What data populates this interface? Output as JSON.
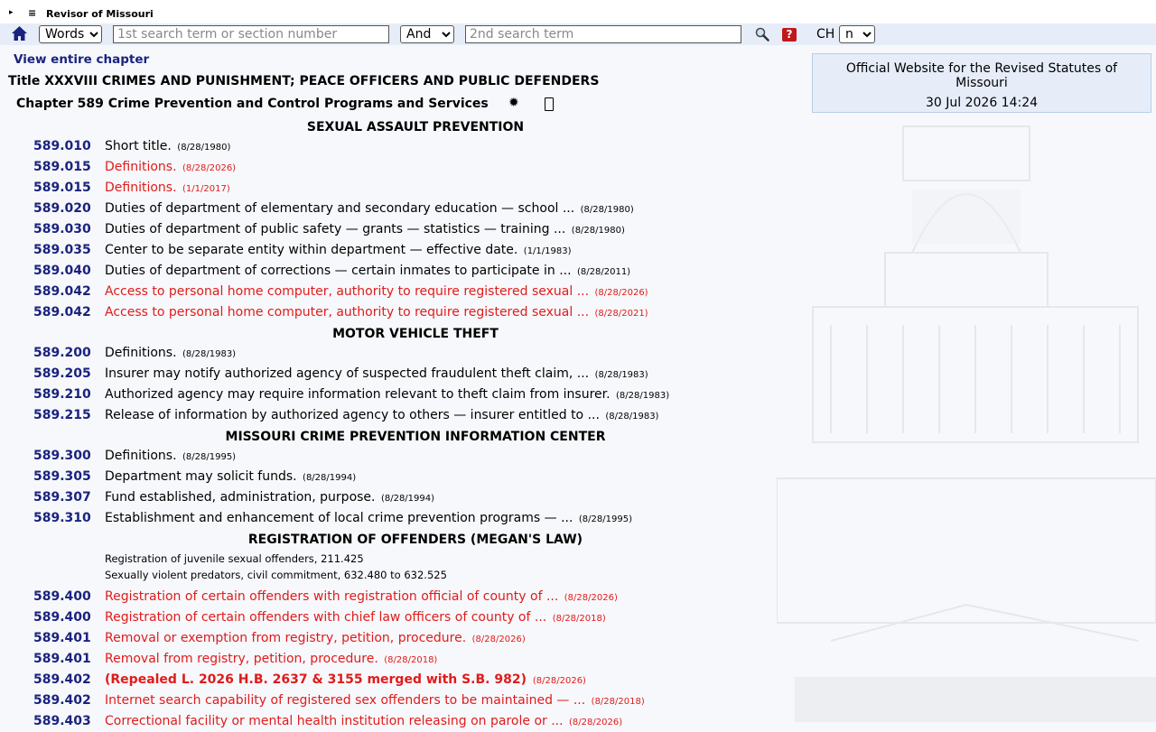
{
  "topbar": {
    "expand_glyph": "▸",
    "menu_glyph": "≡",
    "site_name": "Revisor of Missouri"
  },
  "search": {
    "mode_selected": "Words",
    "term1_placeholder": "1st search term or section number",
    "operator_selected": "And",
    "term2_placeholder": "2nd search term",
    "help_label": "?",
    "ch_label": "CH",
    "ch_selected": "n"
  },
  "nav": {
    "view_chapter": "View entire chapter"
  },
  "header": {
    "title": "Title XXXVIII CRIMES AND PUNISHMENT; PEACE OFFICERS AND PUBLIC DEFENDERS",
    "chapter": "Chapter 589 Crime Prevention and Control Programs and Services",
    "star_glyph": "✹"
  },
  "info": {
    "line1": "Official Website for the Revised Statutes of Missouri",
    "line2": "30 Jul 2026 14:24"
  },
  "headings": [
    "SEXUAL ASSAULT PREVENTION",
    "MOTOR VEHICLE THEFT",
    "MISSOURI CRIME PREVENTION INFORMATION CENTER",
    "REGISTRATION OF OFFENDERS (MEGAN'S LAW)"
  ],
  "notes": [
    "Registration of juvenile sexual offenders, 211.425",
    "Sexually violent predators, civil commitment, 632.480 to 632.525"
  ],
  "sections": [
    {
      "num": "589.010",
      "desc": "Short title.",
      "date": "(8/28/1980)",
      "style": "normal"
    },
    {
      "num": "589.015",
      "desc": "Definitions.",
      "date": "(8/28/2026)",
      "style": "red"
    },
    {
      "num": "589.015",
      "desc": "Definitions.",
      "date": "(1/1/2017)",
      "style": "red"
    },
    {
      "num": "589.020",
      "desc": "Duties of department of elementary and secondary education — school ...",
      "date": "(8/28/1980)",
      "style": "normal"
    },
    {
      "num": "589.030",
      "desc": "Duties of department of public safety — grants — statistics — training ...",
      "date": "(8/28/1980)",
      "style": "normal"
    },
    {
      "num": "589.035",
      "desc": "Center to be separate entity within department — effective date.",
      "date": "(1/1/1983)",
      "style": "normal"
    },
    {
      "num": "589.040",
      "desc": "Duties of department of corrections — certain inmates to participate in ...",
      "date": "(8/28/2011)",
      "style": "normal"
    },
    {
      "num": "589.042",
      "desc": "Access to personal home computer, authority to require registered sexual ...",
      "date": "(8/28/2026)",
      "style": "red"
    },
    {
      "num": "589.042",
      "desc": "Access to personal home computer, authority to require registered sexual ...",
      "date": "(8/28/2021)",
      "style": "red"
    },
    {
      "num": "589.200",
      "desc": "Definitions.",
      "date": "(8/28/1983)",
      "style": "normal"
    },
    {
      "num": "589.205",
      "desc": "Insurer may notify authorized agency of suspected fraudulent theft claim, ...",
      "date": "(8/28/1983)",
      "style": "normal"
    },
    {
      "num": "589.210",
      "desc": "Authorized agency may require information relevant to theft claim from insurer.",
      "date": "(8/28/1983)",
      "style": "normal"
    },
    {
      "num": "589.215",
      "desc": "Release of information by authorized agency to others — insurer entitled to ...",
      "date": "(8/28/1983)",
      "style": "normal"
    },
    {
      "num": "589.300",
      "desc": "Definitions.",
      "date": "(8/28/1995)",
      "style": "normal"
    },
    {
      "num": "589.305",
      "desc": "Department may solicit funds.",
      "date": "(8/28/1994)",
      "style": "normal"
    },
    {
      "num": "589.307",
      "desc": "Fund established, administration, purpose.",
      "date": "(8/28/1994)",
      "style": "normal"
    },
    {
      "num": "589.310",
      "desc": "Establishment and enhancement of local crime prevention programs — ...",
      "date": "(8/28/1995)",
      "style": "normal"
    },
    {
      "num": "589.400",
      "desc": "Registration of certain offenders with registration official of county of ...",
      "date": "(8/28/2026)",
      "style": "red"
    },
    {
      "num": "589.400",
      "desc": "Registration of certain offenders with chief law officers of county of ...",
      "date": "(8/28/2018)",
      "style": "red"
    },
    {
      "num": "589.401",
      "desc": "Removal or exemption from registry, petition, procedure.",
      "date": "(8/28/2026)",
      "style": "red"
    },
    {
      "num": "589.401",
      "desc": "Removal from registry, petition, procedure.",
      "date": "(8/28/2018)",
      "style": "red"
    },
    {
      "num": "589.402",
      "desc": "(Repealed L. 2026 H.B. 2637 & 3155 merged with S.B. 982)",
      "date": "(8/28/2026)",
      "style": "redbold"
    },
    {
      "num": "589.402",
      "desc": "Internet search capability of registered sex offenders to be maintained — ...",
      "date": "(8/28/2018)",
      "style": "red"
    },
    {
      "num": "589.403",
      "desc": "Correctional facility or mental health institution releasing on parole or ...",
      "date": "(8/28/2026)",
      "style": "red"
    }
  ]
}
